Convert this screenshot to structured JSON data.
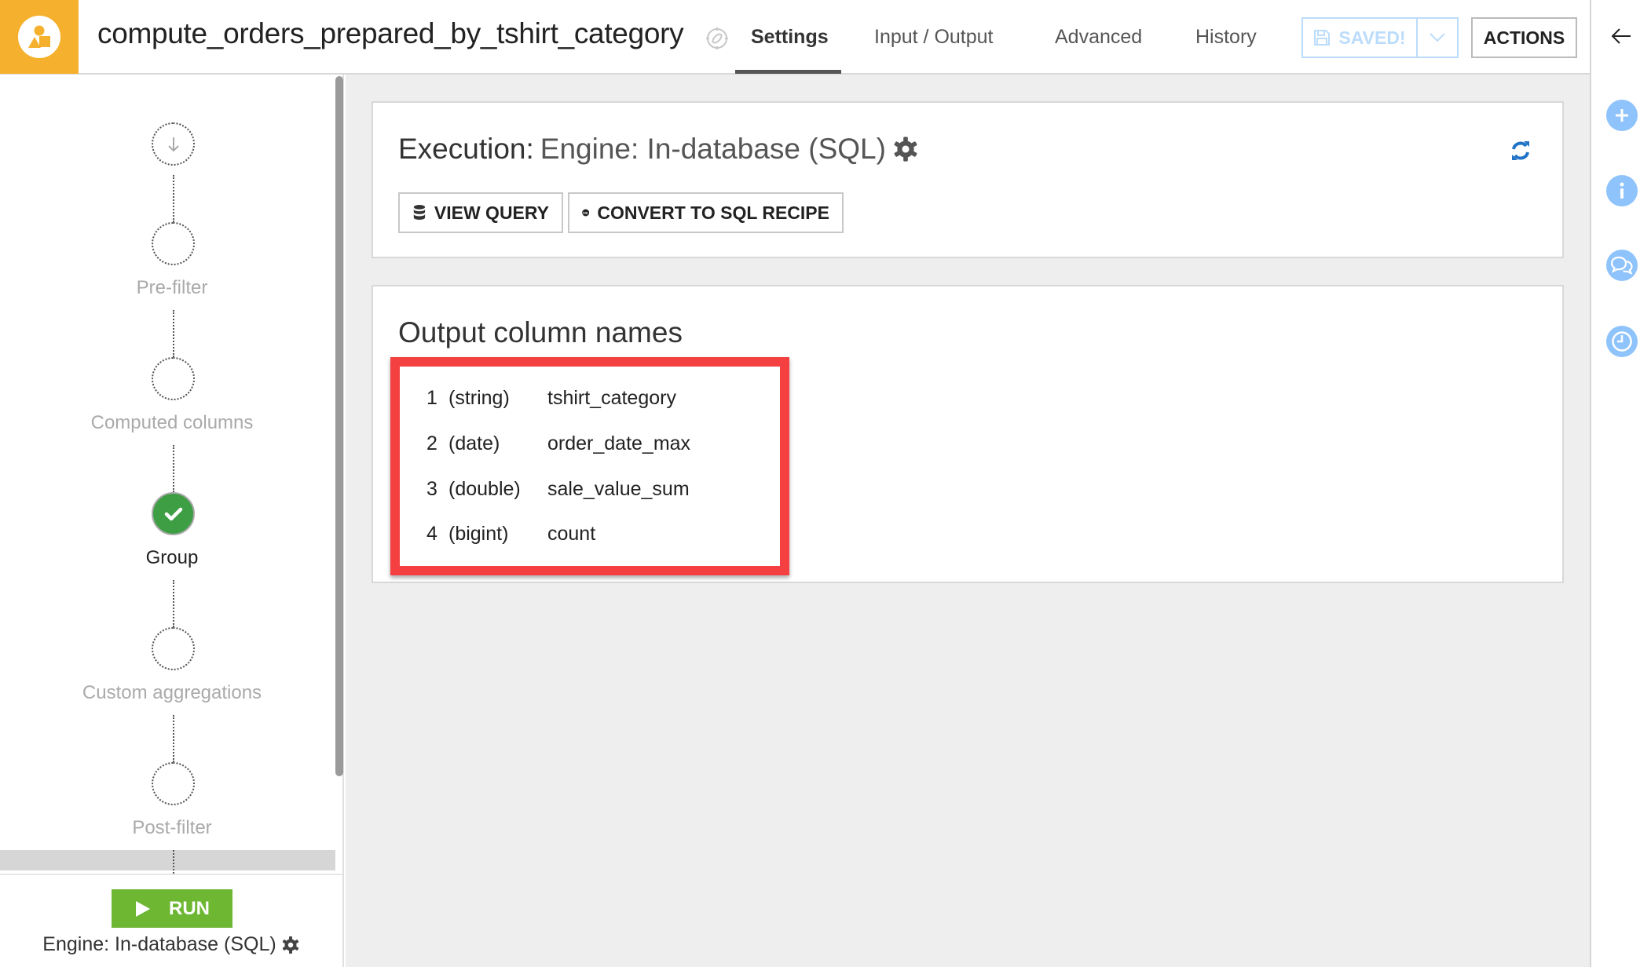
{
  "header": {
    "recipe_name": "compute_orders_prepared_by_tshirt_category",
    "tabs": [
      {
        "label": "Settings",
        "active": true
      },
      {
        "label": "Input / Output",
        "active": false
      },
      {
        "label": "Advanced",
        "active": false
      },
      {
        "label": "History",
        "active": false
      }
    ],
    "save_label": "SAVED!",
    "actions_label": "ACTIONS",
    "colors": {
      "logo_bg": "#f5b02e",
      "saved": "#bcdcfb"
    }
  },
  "sidebar": {
    "steps": [
      {
        "label": "",
        "icon": "arrow-down-icon",
        "state": "inactive"
      },
      {
        "label": "Pre-filter",
        "state": "inactive"
      },
      {
        "label": "Computed columns",
        "state": "inactive"
      },
      {
        "label": "Group",
        "state": "done"
      },
      {
        "label": "Custom aggregations",
        "state": "inactive"
      },
      {
        "label": "Post-filter",
        "state": "inactive"
      }
    ],
    "run_label": "RUN",
    "engine_label": "Engine: In-database (SQL)",
    "colors": {
      "run": "#6db733",
      "done": "#3d9e44"
    }
  },
  "execution": {
    "title_label": "Execution:",
    "engine_value": "Engine: In-database (SQL)",
    "view_query_label": "VIEW QUERY",
    "convert_label": "CONVERT TO SQL RECIPE",
    "sql_badge": "SQL"
  },
  "output_columns": {
    "title": "Output column names",
    "columns": [
      {
        "index": "1",
        "type": "(string)",
        "name": "tshirt_category"
      },
      {
        "index": "2",
        "type": "(date)",
        "name": "order_date_max"
      },
      {
        "index": "3",
        "type": "(double)",
        "name": "sale_value_sum"
      },
      {
        "index": "4",
        "type": "(bigint)",
        "name": "count"
      }
    ],
    "highlight_color": "#f44040"
  },
  "right_rail": {
    "items": [
      "back-arrow-icon",
      "plus-icon",
      "info-icon",
      "discussions-icon",
      "history-clock-icon"
    ]
  }
}
